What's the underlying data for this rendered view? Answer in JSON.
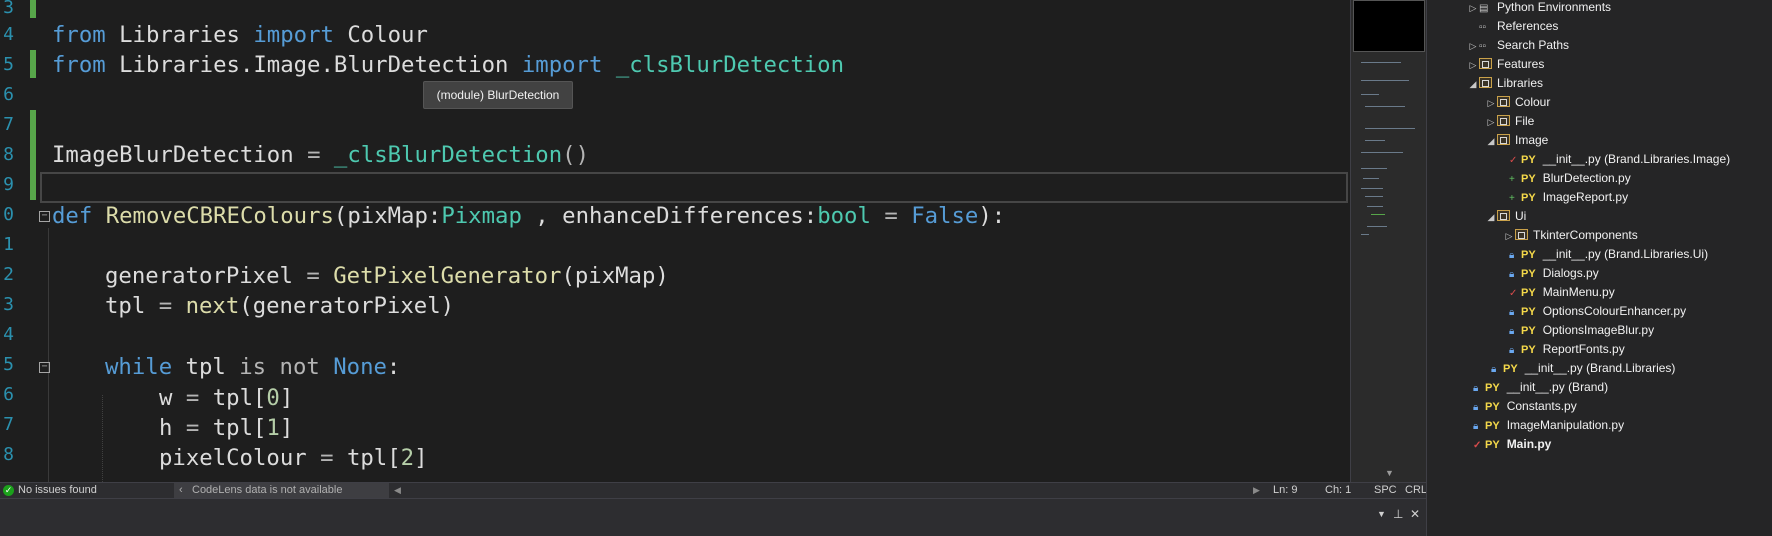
{
  "editor": {
    "line_numbers": [
      "3",
      "4",
      "5",
      "6",
      "7",
      "8",
      "9",
      "0",
      "1",
      "2",
      "3",
      "4",
      "5",
      "6",
      "7",
      "8"
    ],
    "lines": {
      "l4": {
        "kw1": "from",
        "mod": " Libraries ",
        "kw2": "import",
        "name": " Colour"
      },
      "l5": {
        "kw1": "from",
        "mod": " Libraries.Image.BlurDetection ",
        "kw2": "import",
        "cls": " _clsBlurDetection"
      },
      "l8": {
        "var": "ImageBlurDetection",
        "op": " = ",
        "cls": "_clsBlurDetection",
        "paren": "()"
      },
      "l10": {
        "kw": "def",
        "fn": " RemoveCBREColours",
        "p1": "(pixMap:",
        "t1": "Pixmap",
        "p2": " , enhanceDifferences:",
        "t2": "bool",
        "p3": " = ",
        "val": "False",
        "p4": "):"
      },
      "l12": {
        "var": "generatorPixel",
        "op": " = ",
        "fn": "GetPixelGenerator",
        "args": "(pixMap)"
      },
      "l13": {
        "var": "tpl",
        "op": " = ",
        "fn": "next",
        "args": "(generatorPixel)"
      },
      "l15": {
        "kw": "while",
        "var": " tpl ",
        "kw2": "is not",
        "none": " None",
        "colon": ":"
      },
      "l16": {
        "var": "w",
        "op": " = ",
        "obj": "tpl[",
        "num": "0",
        "close": "]"
      },
      "l17": {
        "var": "h",
        "op": " = ",
        "obj": "tpl[",
        "num": "1",
        "close": "]"
      },
      "l18": {
        "var": "pixelColour",
        "op": " = ",
        "obj": "tpl[",
        "num": "2",
        "close": "]"
      }
    },
    "tooltip": "(module) BlurDetection"
  },
  "statusbar": {
    "issues": "No issues found",
    "codelens": "CodeLens data is not available",
    "ln": "Ln: 9",
    "ch": "Ch: 1",
    "spc": "SPC",
    "crlf": "CRLF"
  },
  "explorer": {
    "items": [
      {
        "label": "Python Environments"
      },
      {
        "label": "References"
      },
      {
        "label": "Search Paths"
      },
      {
        "label": "Features"
      },
      {
        "label": "Libraries"
      },
      {
        "label": "Colour"
      },
      {
        "label": "File"
      },
      {
        "label": "Image"
      },
      {
        "label": "__init__.py (Brand.Libraries.Image)"
      },
      {
        "label": "BlurDetection.py"
      },
      {
        "label": "ImageReport.py"
      },
      {
        "label": "Ui"
      },
      {
        "label": "TkinterComponents"
      },
      {
        "label": "__init__.py (Brand.Libraries.Ui)"
      },
      {
        "label": "Dialogs.py"
      },
      {
        "label": "MainMenu.py"
      },
      {
        "label": "OptionsColourEnhancer.py"
      },
      {
        "label": "OptionsImageBlur.py"
      },
      {
        "label": "ReportFonts.py"
      },
      {
        "label": "__init__.py (Brand.Libraries)"
      },
      {
        "label": "__init__.py (Brand)"
      },
      {
        "label": "Constants.py"
      },
      {
        "label": "ImageManipulation.py"
      },
      {
        "label": "Main.py"
      }
    ],
    "py_tag": "PY"
  },
  "colors": {
    "keyword": "#569cd6",
    "class": "#4ec9b0",
    "function": "#dcdcaa",
    "change_marker": "#57a64a"
  }
}
